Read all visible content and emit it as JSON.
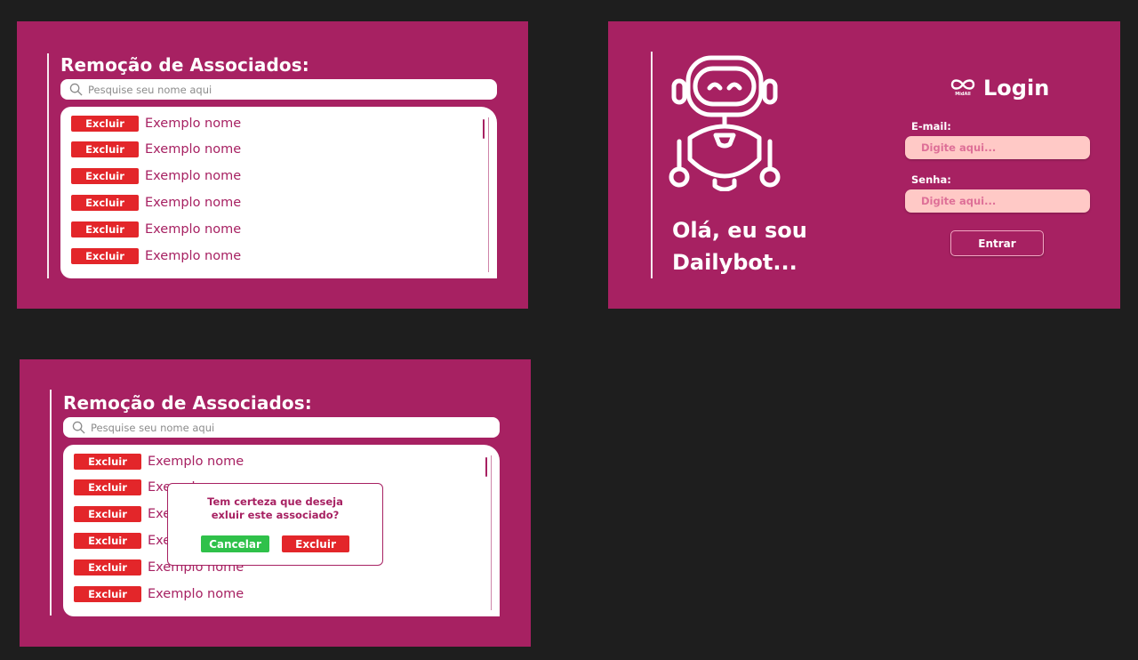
{
  "colors": {
    "background": "#1e1e1e",
    "brand": "#a72162",
    "danger": "#e3262a",
    "success": "#2fc14a",
    "field": "#ffc9c6"
  },
  "removal": {
    "title": "Remoção de Associados:",
    "search_placeholder": "Pesquise seu nome aqui",
    "delete_label": "Excluir",
    "items": [
      "Exemplo nome",
      "Exemplo nome",
      "Exemplo nome",
      "Exemplo nome",
      "Exemplo nome",
      "Exemplo nome"
    ]
  },
  "login": {
    "greeting_line1": "Olá, eu sou",
    "greeting_line2": "Dailybot...",
    "logo_text": "MidAll",
    "title": "Login",
    "email_label": "E-mail:",
    "email_placeholder": "Digite aqui...",
    "password_label": "Senha:",
    "password_placeholder": "Digite aqui...",
    "submit_label": "Entrar",
    "mascot_icon": "robot-icon",
    "logo_icon": "infinity-icon"
  },
  "removal_confirm": {
    "title": "Remoção de Associados:",
    "search_placeholder": "Pesquise seu nome aqui",
    "delete_label": "Excluir",
    "items": [
      "Exemplo nome",
      "Exemplo nome",
      "Exemplo nome",
      "Exemplo nome",
      "Exemplo nome",
      "Exemplo nome"
    ],
    "dialog": {
      "line1": "Tem certeza que deseja",
      "line2": "exluir este associado?",
      "cancel_label": "Cancelar",
      "confirm_label": "Excluir"
    }
  }
}
